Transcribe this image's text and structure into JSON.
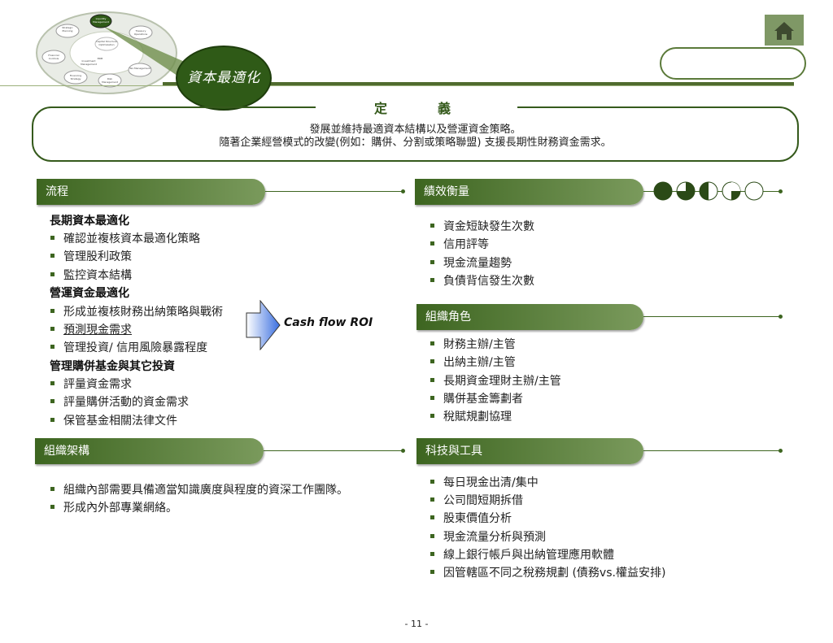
{
  "header": {
    "title": "資本最適化",
    "wheel_labels": [
      "Strategic Planning",
      "Liquidity Management",
      "Capital Structure Optimization",
      "Treasury Operations",
      "Financial Controls",
      "Financing Strategy",
      "Risk Management",
      "Tax Management",
      "Investment Management",
      "ERM"
    ]
  },
  "definition": {
    "title": "定　　義",
    "line1": "發展並維持最適資本結構以及營運資金策略。",
    "line2": "隨著企業經營模式的改變(例如：購併、分割或策略聯盟) 支援長期性財務資金需求。"
  },
  "process": {
    "heading": "流程",
    "groups": [
      {
        "title": "長期資本最適化",
        "items": [
          "確認並複核資本最適化策略",
          "管理股利政策",
          "監控資本結構"
        ]
      },
      {
        "title": "營運資金最適化",
        "items": [
          "形成並複核財務出納策略與戰術",
          "預測現金需求",
          "管理投資/ 信用風險暴露程度"
        ]
      },
      {
        "title": "管理購併基金與其它投資",
        "items": [
          "評量資金需求",
          "評量購併活動的資金需求",
          "保管基金相關法律文件"
        ]
      }
    ],
    "callout": "Cash flow ROI"
  },
  "performance": {
    "heading": "績效衡量",
    "items": [
      "資金短缺發生次數",
      "信用評等",
      "現金流量趨勢",
      "負債背信發生次數"
    ],
    "harvey_balls": [
      1.0,
      0.75,
      0.5,
      0.25,
      0.0
    ]
  },
  "roles": {
    "heading": "組織角色",
    "items": [
      "財務主辦/主管",
      "出納主辦/主管",
      "長期資金理財主辦/主管",
      "購併基金籌劃者",
      "稅賦規劃協理"
    ]
  },
  "structure": {
    "heading": "組織架構",
    "items": [
      "組織內部需要具備適當知識廣度與程度的資深工作團隊。",
      "形成內外部專業網絡。"
    ]
  },
  "tools": {
    "heading": "科技與工具",
    "items": [
      "每日現金出清/集中",
      "公司間短期拆借",
      "股東價值分析",
      "現金流量分析與預測",
      "線上銀行帳戶與出納管理應用軟體",
      "因管轄區不同之稅務規劃 (債務vs.權益安排)"
    ]
  },
  "footer": {
    "page": "- 11 -"
  },
  "colors": {
    "primary": "#355a1c",
    "accent": "#7a9a5c"
  }
}
